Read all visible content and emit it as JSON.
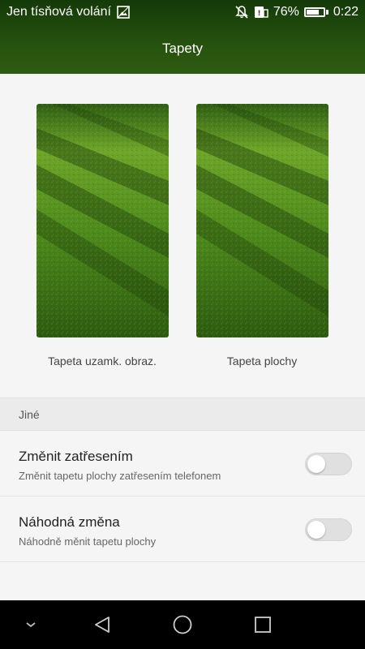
{
  "status_bar": {
    "carrier_text": "Jen tísňová volání",
    "battery_percent": "76%",
    "battery_level": 0.76,
    "time": "0:22",
    "icons": [
      "image-icon",
      "mute-icon",
      "battery-saver-icon",
      "battery-icon"
    ]
  },
  "header": {
    "title": "Tapety"
  },
  "wallpapers": {
    "lock_label": "Tapeta uzamk. obraz.",
    "home_label": "Tapeta plochy"
  },
  "section": {
    "other_label": "Jiné"
  },
  "settings": [
    {
      "title": "Změnit zatřesením",
      "subtitle": "Změnit tapetu plochy zatřesením telefonem",
      "enabled": false
    },
    {
      "title": "Náhodná změna",
      "subtitle": "Náhodně měnit tapetu plochy",
      "enabled": false
    }
  ],
  "colors": {
    "header_top": "#143a09",
    "header_bottom": "#2f5c12",
    "background": "#f5f5f5",
    "grass": "#4f8a1c"
  },
  "navbar": {
    "icons": [
      "chevron-down-icon",
      "back-icon",
      "home-icon",
      "recents-icon"
    ]
  }
}
